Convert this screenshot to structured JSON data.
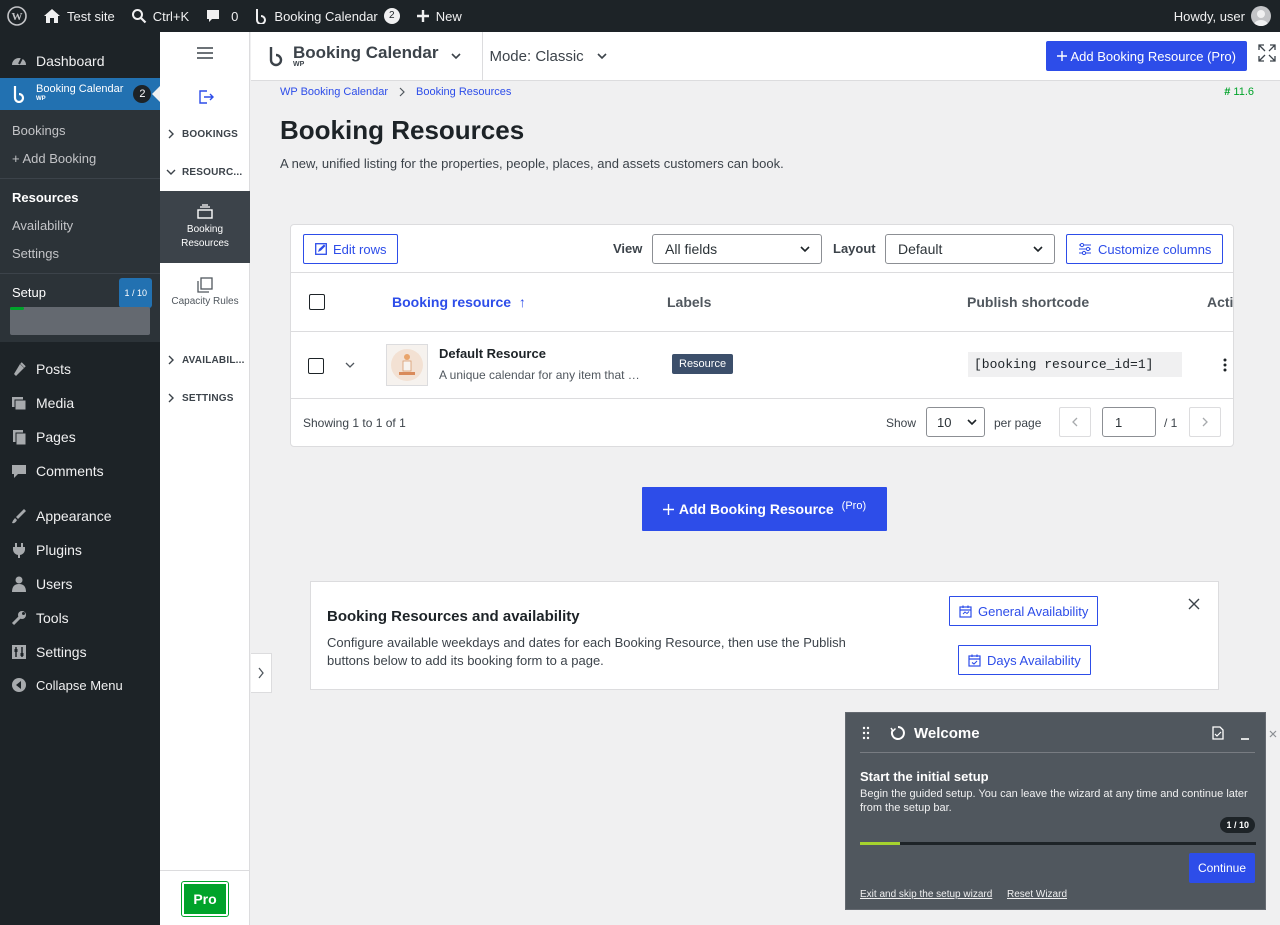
{
  "adminbar": {
    "site": "Test site",
    "search": "Ctrl+K",
    "comments": "0",
    "plugin": "Booking Calendar",
    "plugin_count": "2",
    "new": "New",
    "howdy": "Howdy, user"
  },
  "adminmenu": {
    "dashboard": "Dashboard",
    "current": "Booking Calendar",
    "current_sub": "WP",
    "current_count": "2",
    "sub": {
      "bookings": "Bookings",
      "add_booking": "+ Add Booking",
      "resources": "Resources",
      "availability": "Availability",
      "settings": "Settings"
    },
    "setup": "Setup",
    "setup_badge": "1 / 10",
    "setup_progress": 0.1,
    "items": [
      "Posts",
      "Media",
      "Pages",
      "Comments",
      "Appearance",
      "Plugins",
      "Users",
      "Tools",
      "Settings",
      "Collapse Menu"
    ]
  },
  "pluginnav": {
    "bookings": "BOOKINGS",
    "resources": "RESOURC...",
    "tile_resources": "Booking Resources",
    "tile_capacity": "Capacity Rules",
    "availability": "AVAILABIL...",
    "settings": "SETTINGS",
    "pro": "Pro"
  },
  "topbar": {
    "brand": "Booking Calendar",
    "brand_sub": "WP",
    "mode": "Mode: Classic",
    "add_button": "Add Booking Resource (Pro)"
  },
  "breadcrumb": [
    "WP Booking Calendar",
    "Booking Resources"
  ],
  "version": "11.6",
  "page": {
    "title": "Booking Resources",
    "description": "A new, unified listing for the properties, people, places, and assets customers can book."
  },
  "toolbar": {
    "edit_rows": "Edit rows",
    "view_label": "View",
    "view_value": "All fields",
    "layout_label": "Layout",
    "layout_value": "Default",
    "customize": "Customize columns"
  },
  "table": {
    "columns": [
      "Booking resource",
      "Labels",
      "Publish shortcode",
      "Acti"
    ],
    "sort_indicator": "↑",
    "rows": [
      {
        "name": "Default Resource",
        "description": "A unique calendar for any item that …",
        "label": "Resource",
        "shortcode": "[booking resource_id=1]"
      }
    ]
  },
  "footer": {
    "showing": "Showing 1 to 1 of 1",
    "show_label": "Show",
    "per_page_value": "10",
    "per_page_label": "per page",
    "page_value": "1",
    "page_total": "/ 1"
  },
  "big_add": {
    "label": "Add Booking Resource",
    "sup": "(Pro)"
  },
  "availability_notice": {
    "title": "Booking Resources and availability",
    "text": "Configure available weekdays and dates for each Booking Resource, then use the Publish buttons below to add its booking form to a page.",
    "general_button": "General Availability",
    "days_button": "Days Availability"
  },
  "welcome": {
    "title": "Welcome",
    "heading": "Start the initial setup",
    "text": "Begin the guided setup. You can leave the wizard at any time and continue later from the setup bar.",
    "badge": "1 / 10",
    "progress": 0.1,
    "continue": "Continue",
    "exit": "Exit and skip the setup wizard",
    "reset": "Reset Wizard"
  },
  "colors": {
    "accent": "#2d4de9",
    "wp_dark": "#1d2327",
    "wp_blue": "#2271b1",
    "success": "#00a32a"
  }
}
